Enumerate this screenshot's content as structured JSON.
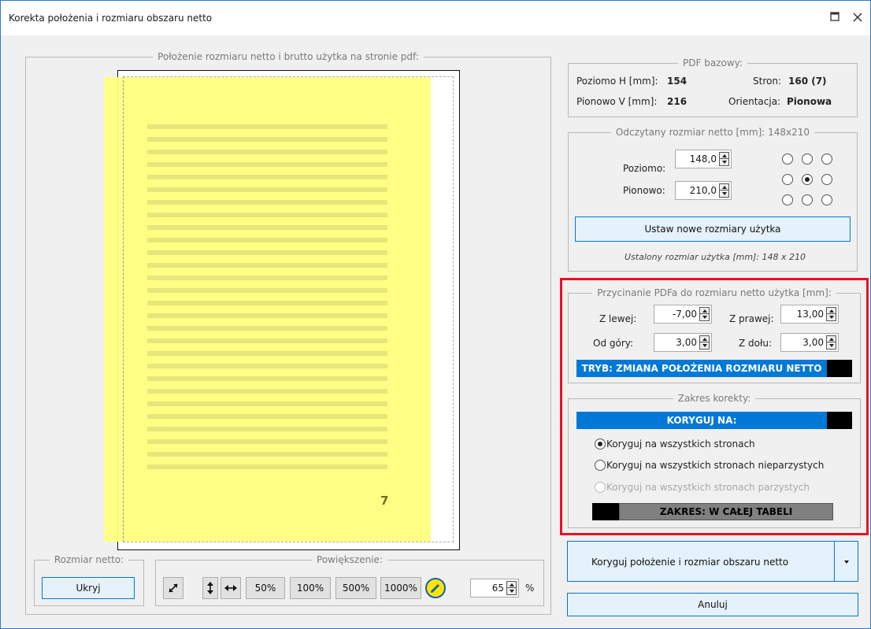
{
  "window": {
    "title": "Korekta położenia i rozmiaru obszaru netto",
    "maximize_icon": "maximize-icon",
    "close_icon": "close-icon"
  },
  "preview": {
    "legend": "Położenie rozmiaru netto i brutto użytka na stronie pdf:",
    "page_number": "7",
    "overlay_color": "#ffff80"
  },
  "netto_size": {
    "legend": "Rozmiar netto:",
    "hide_button": "Ukryj"
  },
  "zoom": {
    "legend": "Powiększenie:",
    "fit_icon": "fit-page-icon",
    "fit_height_icon": "fit-height-icon",
    "fit_width_icon": "fit-width-icon",
    "levels": [
      "50%",
      "100%",
      "500%",
      "1000%"
    ],
    "edit_icon": "pencil-icon",
    "value": "65",
    "unit": "%"
  },
  "pdf_base": {
    "legend": "PDF bazowy:",
    "h_label": "Poziomo H [mm]:",
    "h_value": "154",
    "pages_label": "Stron:",
    "pages_value": "160 (7)",
    "v_label": "Pionowo V [mm]:",
    "v_value": "216",
    "orientation_label": "Orientacja:",
    "orientation_value": "Pionowa"
  },
  "read_size": {
    "legend": "Odczytany rozmiar netto [mm]: 148x210",
    "horizontal_label": "Poziomo:",
    "horizontal_value": "148,0",
    "vertical_label": "Pionowo:",
    "vertical_value": "210,0",
    "anchor_selected": "center",
    "set_button": "Ustaw nowe rozmiary użytka",
    "set_size_note": "Ustalony rozmiar użytka [mm]: 148 x 210"
  },
  "crop": {
    "legend": "Przycinanie PDFa do rozmiaru netto użytka [mm]:",
    "left_label": "Z lewej:",
    "left_value": "-7,00",
    "right_label": "Z prawej:",
    "right_value": "13,00",
    "top_label": "Od góry:",
    "top_value": "3,00",
    "bottom_label": "Z dołu:",
    "bottom_value": "3,00",
    "mode_bar": "TRYB: ZMIANA POŁOŻENIA ROZMIARU NETTO",
    "highlight_color": "#e81123",
    "accent_color": "#0078d7"
  },
  "scope": {
    "legend": "Zakres korekty:",
    "header_bar": "KORYGUJ NA:",
    "options": [
      "Koryguj na wszystkich stronach",
      "Koryguj na wszystkich stronach nieparzystych",
      "Koryguj na wszystkich stronach parzystych"
    ],
    "selected_option": "Koryguj na wszystkich stronach",
    "range_bar": "ZAKRES: W CAŁEJ TABELI"
  },
  "actions": {
    "apply_button": "Koryguj położenie i rozmiar obszaru netto",
    "dropdown_icon": "dropdown-arrow-icon",
    "cancel_button": "Anuluj"
  }
}
